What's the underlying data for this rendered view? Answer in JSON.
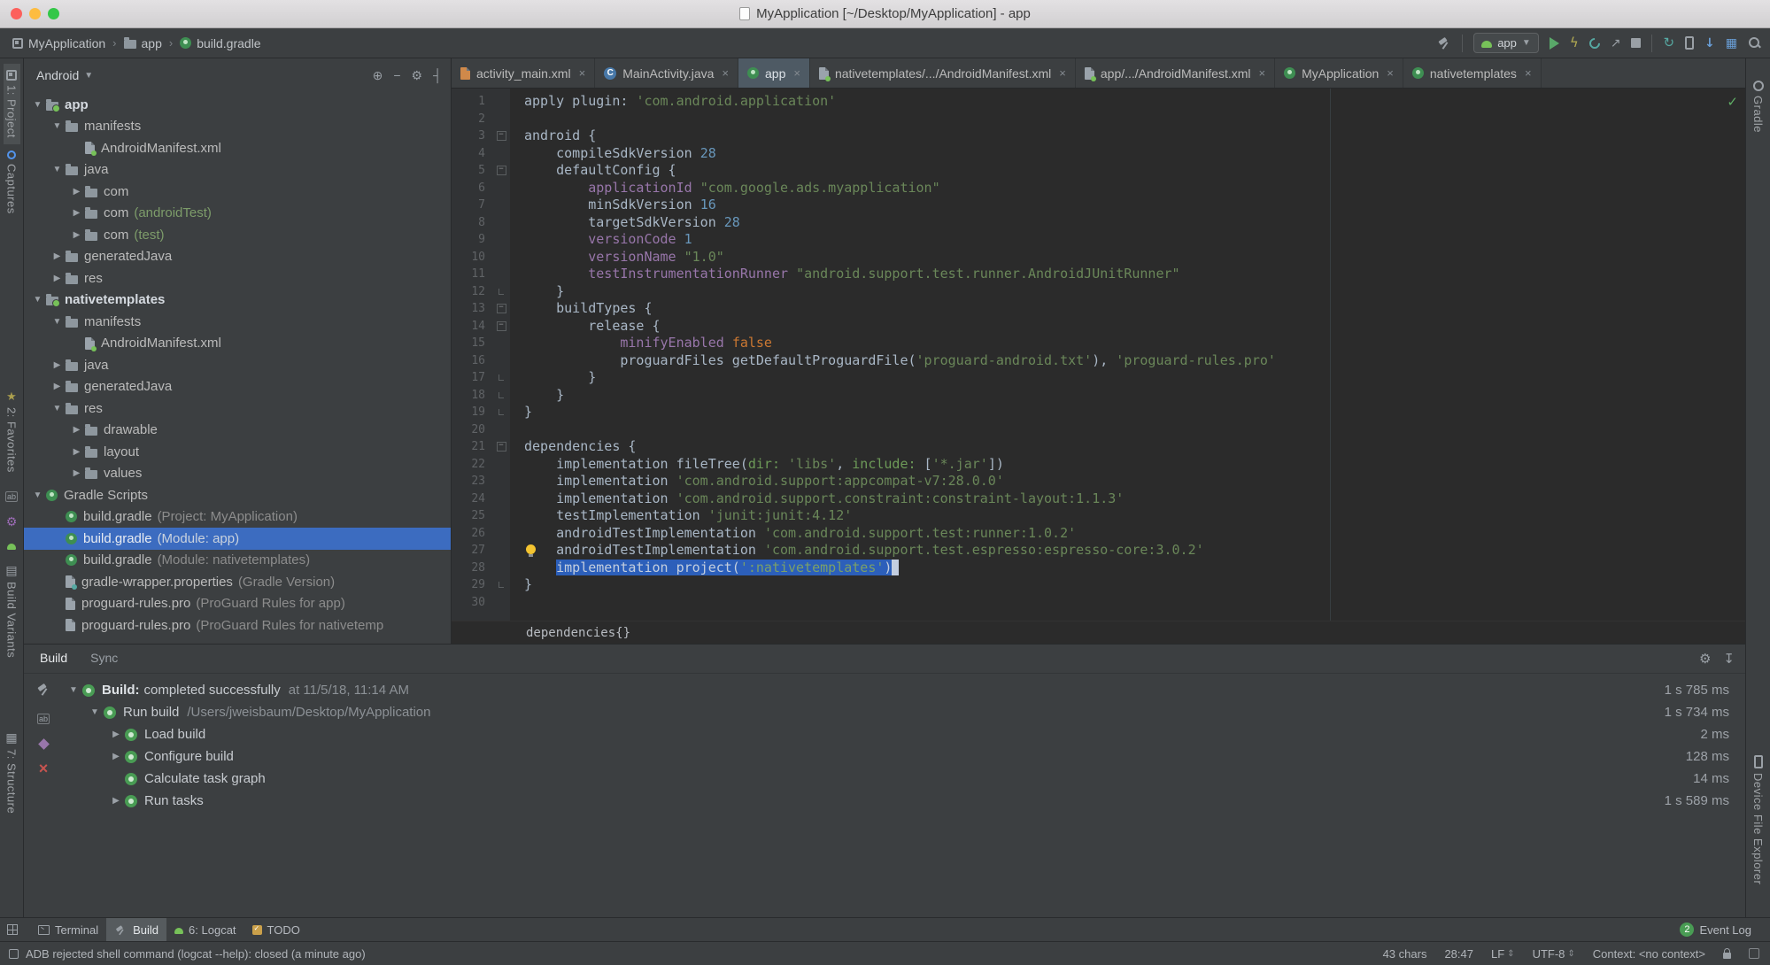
{
  "titlebar": {
    "title": "MyApplication [~/Desktop/MyApplication] - app"
  },
  "toolbar": {
    "breadcrumbs": [
      {
        "label": "MyApplication",
        "icon": "project-icon"
      },
      {
        "label": "app",
        "icon": "folder-icon"
      },
      {
        "label": "build.gradle",
        "icon": "gradle-icon"
      }
    ],
    "run_config_label": "app",
    "actions": [
      {
        "name": "build-hammer-button",
        "icon": "hammer-icon"
      },
      {
        "name": "run-config-select",
        "icon": "android-icon",
        "label": "app"
      },
      {
        "name": "run-button",
        "icon": "play-icon"
      },
      {
        "name": "apply-changes-button",
        "icon": "lightning-icon"
      },
      {
        "name": "profiler-button",
        "icon": "profiler-icon"
      },
      {
        "name": "attach-debugger-button",
        "icon": "attach-icon"
      },
      {
        "name": "stop-button",
        "icon": "stop-icon"
      },
      {
        "name": "sync-project-button",
        "icon": "sync-icon"
      },
      {
        "name": "avd-manager-button",
        "icon": "phone-icon"
      },
      {
        "name": "sdk-manager-button",
        "icon": "sdk-icon"
      },
      {
        "name": "layout-inspector-button",
        "icon": "grid-icon"
      },
      {
        "name": "search-everywhere-button",
        "icon": "search-icon"
      }
    ]
  },
  "project": {
    "selector": "Android",
    "header_icons": [
      {
        "name": "scroll-from-source-icon",
        "glyph": "⊕"
      },
      {
        "name": "collapse-all-icon",
        "glyph": "−"
      },
      {
        "name": "settings-gear-icon",
        "glyph": "⚙"
      },
      {
        "name": "hide-panel-icon",
        "glyph": "┤"
      }
    ],
    "tree": [
      {
        "label": "app",
        "level": 0,
        "arrow": "down",
        "icon": "module",
        "bold": true
      },
      {
        "label": "manifests",
        "level": 1,
        "arrow": "down",
        "icon": "folder"
      },
      {
        "label": "AndroidManifest.xml",
        "level": 2,
        "arrow": "none",
        "icon": "manifest"
      },
      {
        "label": "java",
        "level": 1,
        "arrow": "down",
        "icon": "folder"
      },
      {
        "label": "com",
        "level": 2,
        "arrow": "right",
        "icon": "package"
      },
      {
        "label": "com",
        "suffix": "(androidTest)",
        "suffix_color": "green",
        "level": 2,
        "arrow": "right",
        "icon": "package"
      },
      {
        "label": "com",
        "suffix": "(test)",
        "suffix_color": "green",
        "level": 2,
        "arrow": "right",
        "icon": "package"
      },
      {
        "label": "generatedJava",
        "level": 1,
        "arrow": "right",
        "icon": "folder"
      },
      {
        "label": "res",
        "level": 1,
        "arrow": "right",
        "icon": "folder"
      },
      {
        "label": "nativetemplates",
        "level": 0,
        "arrow": "down",
        "icon": "module",
        "bold": true
      },
      {
        "label": "manifests",
        "level": 1,
        "arrow": "down",
        "icon": "folder"
      },
      {
        "label": "AndroidManifest.xml",
        "level": 2,
        "arrow": "none",
        "icon": "manifest"
      },
      {
        "label": "java",
        "level": 1,
        "arrow": "right",
        "icon": "folder"
      },
      {
        "label": "generatedJava",
        "level": 1,
        "arrow": "right",
        "icon": "folder"
      },
      {
        "label": "res",
        "level": 1,
        "arrow": "down",
        "icon": "folder"
      },
      {
        "label": "drawable",
        "level": 2,
        "arrow": "right",
        "icon": "folder"
      },
      {
        "label": "layout",
        "level": 2,
        "arrow": "right",
        "icon": "folder"
      },
      {
        "label": "values",
        "level": 2,
        "arrow": "right",
        "icon": "folder"
      },
      {
        "label": "Gradle Scripts",
        "level": 0,
        "arrow": "down",
        "icon": "gradle"
      },
      {
        "label": "build.gradle",
        "suffix": "(Project: MyApplication)",
        "level": 1,
        "arrow": "none",
        "icon": "gradle"
      },
      {
        "label": "build.gradle",
        "suffix": "(Module: app)",
        "level": 1,
        "arrow": "none",
        "icon": "gradle",
        "selected": true
      },
      {
        "label": "build.gradle",
        "suffix": "(Module: nativetemplates)",
        "level": 1,
        "arrow": "none",
        "icon": "gradle"
      },
      {
        "label": "gradle-wrapper.properties",
        "suffix": "(Gradle Version)",
        "level": 1,
        "arrow": "none",
        "icon": "props"
      },
      {
        "label": "proguard-rules.pro",
        "suffix": "(ProGuard Rules for app)",
        "level": 1,
        "arrow": "none",
        "icon": "proguard"
      },
      {
        "label": "proguard-rules.pro",
        "suffix": "(ProGuard Rules for nativetemp",
        "level": 1,
        "arrow": "none",
        "icon": "proguard"
      }
    ]
  },
  "editor": {
    "tabs": [
      {
        "label": "activity_main.xml",
        "icon": "xml-file"
      },
      {
        "label": "MainActivity.java",
        "icon": "java-class"
      },
      {
        "label": "app",
        "icon": "gradle",
        "active": true
      },
      {
        "label": "nativetemplates/.../AndroidManifest.xml",
        "icon": "manifest"
      },
      {
        "label": "app/.../AndroidManifest.xml",
        "icon": "manifest"
      },
      {
        "label": "MyApplication",
        "icon": "gradle"
      },
      {
        "label": "nativetemplates",
        "icon": "gradle"
      }
    ],
    "breadcrumb": "dependencies{}",
    "lines": [
      {
        "t": [
          [
            "d",
            "apply plugin: "
          ],
          [
            "s",
            "'com.android.application'"
          ]
        ]
      },
      {},
      {
        "f": "start",
        "t": [
          [
            "d",
            "android {"
          ]
        ]
      },
      {
        "t": [
          [
            "d",
            "    compileSdkVersion "
          ],
          [
            "n",
            "28"
          ]
        ]
      },
      {
        "f": "start",
        "t": [
          [
            "d",
            "    defaultConfig {"
          ]
        ]
      },
      {
        "t": [
          [
            "d",
            "        "
          ],
          [
            "p",
            "applicationId"
          ],
          [
            "d",
            " "
          ],
          [
            "s",
            "\"com.google.ads.myapplication\""
          ]
        ]
      },
      {
        "t": [
          [
            "d",
            "        minSdkVersion "
          ],
          [
            "n",
            "16"
          ]
        ]
      },
      {
        "t": [
          [
            "d",
            "        targetSdkVersion "
          ],
          [
            "n",
            "28"
          ]
        ]
      },
      {
        "t": [
          [
            "d",
            "        "
          ],
          [
            "p",
            "versionCode"
          ],
          [
            "d",
            " "
          ],
          [
            "n",
            "1"
          ]
        ]
      },
      {
        "t": [
          [
            "d",
            "        "
          ],
          [
            "p",
            "versionName"
          ],
          [
            "d",
            " "
          ],
          [
            "s",
            "\"1.0\""
          ]
        ]
      },
      {
        "t": [
          [
            "d",
            "        "
          ],
          [
            "p",
            "testInstrumentationRunner"
          ],
          [
            "d",
            " "
          ],
          [
            "s",
            "\"android.support.test.runner.AndroidJUnitRunner\""
          ]
        ]
      },
      {
        "f": "end",
        "t": [
          [
            "d",
            "    }"
          ]
        ]
      },
      {
        "f": "start",
        "t": [
          [
            "d",
            "    buildTypes {"
          ]
        ]
      },
      {
        "f": "start",
        "t": [
          [
            "d",
            "        release {"
          ]
        ]
      },
      {
        "t": [
          [
            "d",
            "            "
          ],
          [
            "p",
            "minifyEnabled"
          ],
          [
            "d",
            " "
          ],
          [
            "k",
            "false"
          ]
        ]
      },
      {
        "t": [
          [
            "d",
            "            proguardFiles getDefaultProguardFile("
          ],
          [
            "s",
            "'proguard-android.txt'"
          ],
          [
            "d",
            "), "
          ],
          [
            "s",
            "'proguard-rules.pro'"
          ]
        ]
      },
      {
        "f": "end",
        "t": [
          [
            "d",
            "        }"
          ]
        ]
      },
      {
        "f": "end",
        "t": [
          [
            "d",
            "    }"
          ]
        ]
      },
      {
        "f": "end",
        "t": [
          [
            "d",
            "}"
          ]
        ]
      },
      {},
      {
        "f": "start",
        "t": [
          [
            "d",
            "dependencies {"
          ]
        ]
      },
      {
        "t": [
          [
            "d",
            "    implementation fileTree("
          ],
          [
            "np",
            "dir:"
          ],
          [
            "d",
            " "
          ],
          [
            "s",
            "'libs'"
          ],
          [
            "d",
            ", "
          ],
          [
            "np",
            "include:"
          ],
          [
            "d",
            " ["
          ],
          [
            "s",
            "'*.jar'"
          ],
          [
            "d",
            "])"
          ]
        ]
      },
      {
        "t": [
          [
            "d",
            "    implementation "
          ],
          [
            "s",
            "'com.android.support:appcompat-v7:28.0.0'"
          ]
        ]
      },
      {
        "t": [
          [
            "d",
            "    implementation "
          ],
          [
            "s",
            "'com.android.support.constraint:constraint-layout:1.1.3'"
          ]
        ]
      },
      {
        "t": [
          [
            "d",
            "    testImplementation "
          ],
          [
            "s",
            "'junit:junit:4.12'"
          ]
        ]
      },
      {
        "t": [
          [
            "d",
            "    androidTestImplementation "
          ],
          [
            "s",
            "'com.android.support.test:runner:1.0.2'"
          ]
        ]
      },
      {
        "bulb": true,
        "t": [
          [
            "d",
            "    androidTestImplementation "
          ],
          [
            "s",
            "'com.android.support.test.espresso:espresso-core:3.0.2'"
          ]
        ]
      },
      {
        "t": [
          [
            "d",
            "    "
          ],
          [
            "seld",
            "implementation project("
          ],
          [
            "sels",
            "':nativetemplates'"
          ],
          [
            "seld",
            ")"
          ],
          [
            "caret",
            ""
          ]
        ]
      },
      {
        "f": "end",
        "t": [
          [
            "d",
            "}"
          ]
        ]
      },
      {}
    ]
  },
  "build": {
    "tabs": [
      {
        "label": "Build",
        "active": true
      },
      {
        "label": "Sync",
        "active": false
      }
    ],
    "header_icons": [
      {
        "name": "build-settings-gear-icon",
        "glyph": "⚙"
      },
      {
        "name": "export-build-log-icon",
        "glyph": "↧"
      }
    ],
    "toolbar": [
      {
        "name": "restart-build-icon",
        "kind": "hammer"
      },
      {
        "name": "filter-messages-icon",
        "kind": "ab"
      },
      {
        "name": "build-options-icon",
        "kind": "purple"
      },
      {
        "name": "stop-build-icon",
        "kind": "redx"
      }
    ],
    "rows": [
      {
        "level": 0,
        "arrow": "down",
        "bold": "Build:",
        "label": "complet­ed successfully",
        "note": "at 11/5/18, 11:14 AM",
        "time": "1 s 785 ms"
      },
      {
        "level": 1,
        "arrow": "down",
        "label": "Run build",
        "note": "/Users/jweisbaum/Desktop/MyApplication",
        "time": "1 s 734 ms"
      },
      {
        "level": 2,
        "arrow": "right",
        "label": "Load build",
        "time": "2 ms"
      },
      {
        "level": 2,
        "arrow": "right",
        "label": "Configure build",
        "time": "128 ms"
      },
      {
        "level": 2,
        "arrow": "none",
        "label": "Calculate task graph",
        "time": "14 ms"
      },
      {
        "level": 2,
        "arrow": "right",
        "label": "Run tasks",
        "time": "1 s 589 ms"
      }
    ]
  },
  "bottom_bar": {
    "left_items": [
      {
        "label": "Terminal",
        "icon": "terminal-icon"
      },
      {
        "label": "Build",
        "icon": "build-icon",
        "active": true
      },
      {
        "label": "6: Logcat",
        "icon": "logcat-icon"
      },
      {
        "label": "TODO",
        "icon": "todo-icon"
      }
    ],
    "right_items": [
      {
        "label": "Event Log",
        "icon": "event-log-icon",
        "badge": "2"
      }
    ]
  },
  "status_bar": {
    "message": "ADB rejected shell command (logcat --help): closed (a minute ago)",
    "right_items": [
      {
        "label": "43 chars"
      },
      {
        "label": "28:47"
      },
      {
        "label": "LF",
        "chevron": true
      },
      {
        "label": "UTF-8",
        "chevron": true
      },
      {
        "label": "Context: <no context>"
      }
    ]
  },
  "left_stripe": {
    "top": [
      {
        "label": "1: Project",
        "icon": "project-tool-icon",
        "active": true
      },
      {
        "label": "Captures",
        "icon": "captures-tool-icon"
      }
    ],
    "middle_icons": [
      {
        "name": "ab-tool-icon"
      },
      {
        "name": "wrench-tool-icon"
      },
      {
        "name": "android-tool-icon"
      }
    ],
    "bottom": [
      {
        "label": "2: Favorites",
        "icon": "star-icon"
      },
      {
        "label": "Build Variants",
        "icon": "variants-icon"
      },
      {
        "label": "7: Structure",
        "icon": "structure-icon"
      }
    ]
  },
  "right_stripe": {
    "top": [
      {
        "label": "Gradle",
        "icon": "gradle-tool-icon"
      }
    ],
    "bottom": [
      {
        "label": "Device File Explorer",
        "icon": "device-tool-icon"
      }
    ]
  }
}
